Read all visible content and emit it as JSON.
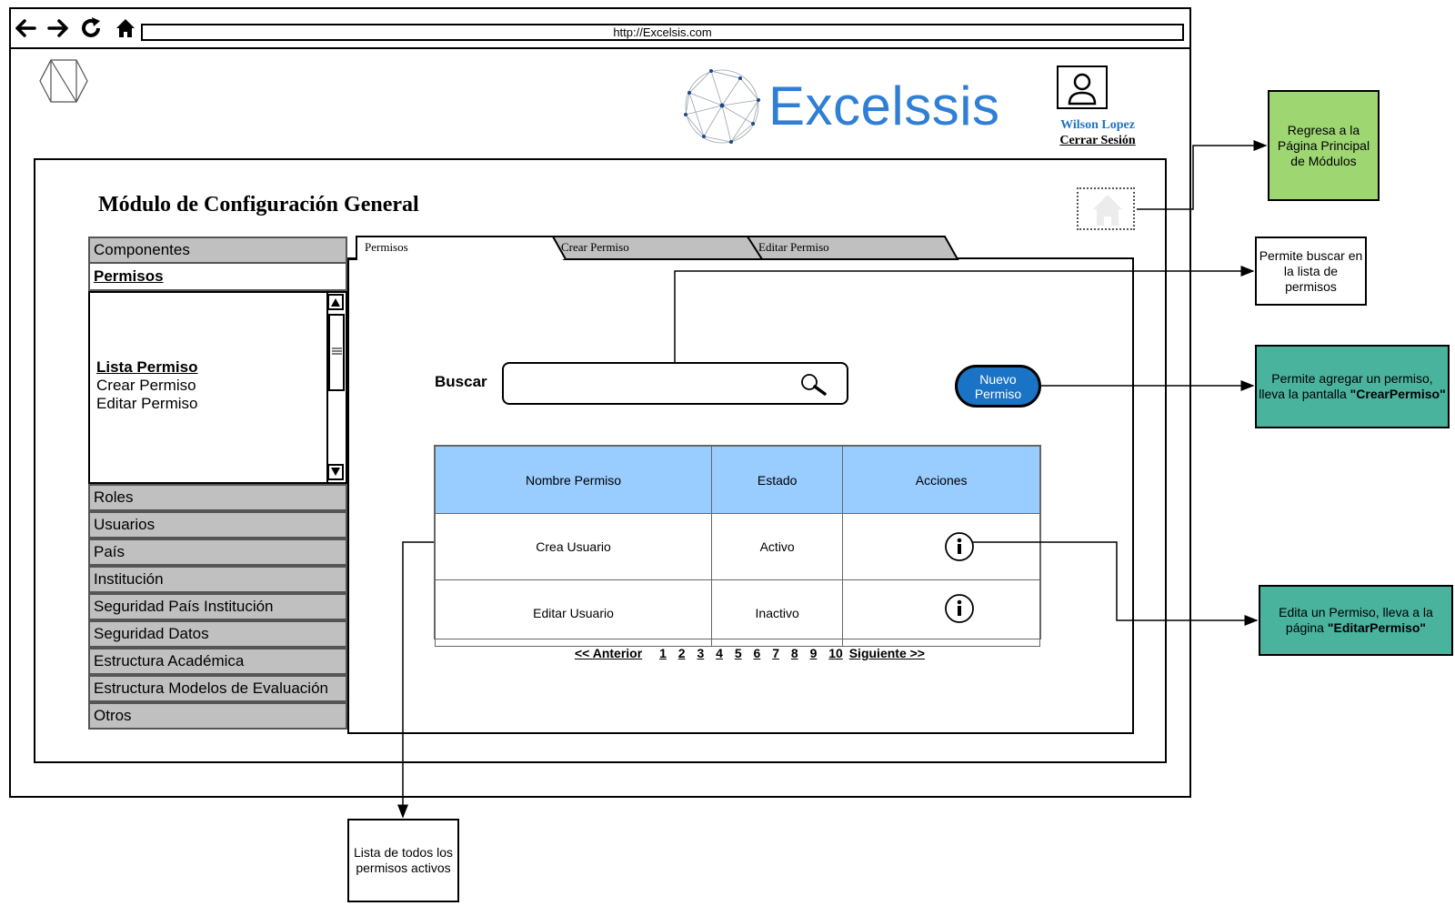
{
  "browser": {
    "url": "http://Excelsis.com"
  },
  "header": {
    "brand": "Excelssis",
    "user_name": "Wilson Lopez",
    "logout": "Cerrar Sesión"
  },
  "module": {
    "title": "Módulo de Configuración General"
  },
  "sidebar": {
    "items_top": [
      "Componentes"
    ],
    "active": "Permisos",
    "sub_items": [
      "Lista Permiso",
      "Crear Permiso",
      "Editar Permiso"
    ],
    "items_bottom": [
      "Roles",
      "Usuarios",
      "País",
      "Institución",
      "Seguridad País Institución",
      "Seguridad Datos",
      "Estructura Académica",
      "Estructura Modelos de Evaluación",
      "Otros"
    ]
  },
  "tabs": [
    "Permisos",
    "Crear Permiso",
    "Editar Permiso"
  ],
  "search": {
    "label": "Buscar",
    "value": ""
  },
  "new_button": {
    "line1": "Nuevo",
    "line2": "Permiso"
  },
  "table": {
    "headers": [
      "Nombre Permiso",
      "Estado",
      "Acciones"
    ],
    "rows": [
      {
        "name": "Crea Usuario",
        "status": "Activo",
        "action_icon": "info-icon"
      },
      {
        "name": "Editar Usuario",
        "status": "Inactivo",
        "action_icon": "info-icon"
      }
    ]
  },
  "pagination": {
    "prev": "<< Anterior",
    "pages": [
      "1",
      "2",
      "3",
      "4",
      "5",
      "6",
      "7",
      "8",
      "9",
      "10"
    ],
    "next": "Siguiente >>"
  },
  "annotations": {
    "home": "Regresa a la Página Principal de Módulos",
    "search": "Permite buscar en la lista de permisos",
    "new_prefix": "Permite agregar un permiso, lleva la pantalla ",
    "new_target": "\"CrearPermiso\"",
    "edit_prefix": "Edita un Permiso, lleva a la página ",
    "edit_target": "\"EditarPermiso\"",
    "list": "Lista de todos los permisos activos"
  },
  "colors": {
    "brand_blue": "#2f7fd5",
    "table_header": "#99ccff",
    "button_blue": "#1a73c4",
    "note_green": "#9ed672",
    "note_teal": "#49b39e",
    "sidebar_gray": "#c0c0c0"
  }
}
